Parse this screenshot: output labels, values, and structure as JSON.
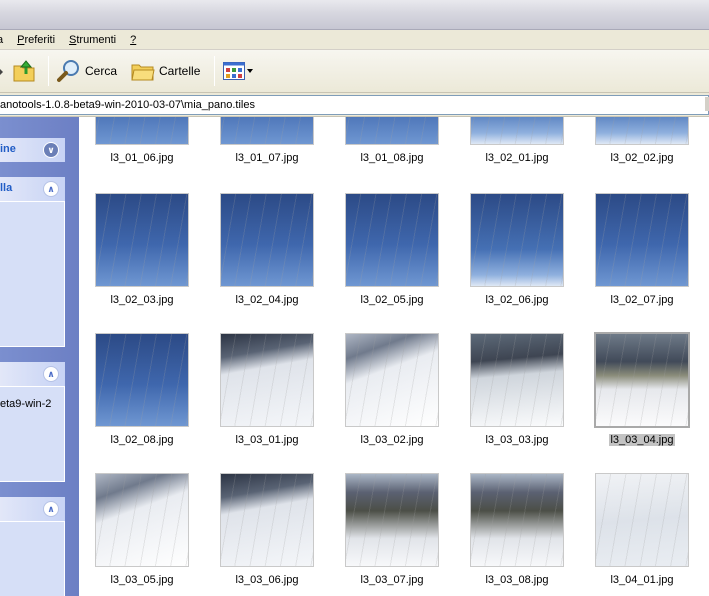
{
  "menu": {
    "items": [
      {
        "label": "a"
      },
      {
        "label": "Preferiti",
        "accel": "P",
        "rest": "referiti"
      },
      {
        "label": "Strumenti",
        "accel": "S",
        "rest": "trumenti"
      },
      {
        "label": "?",
        "accel": "?",
        "rest": ""
      }
    ]
  },
  "toolbar": {
    "search_label": "Cerca",
    "folders_label": "Cartelle"
  },
  "address": {
    "path": "anotools-1.0.8-beta9-win-2010-03-07\\mia_pano.tiles"
  },
  "taskpane": {
    "panel1_title": "ine",
    "panel2_title": "lla",
    "panel3_text": "eta9-win-2"
  },
  "files": [
    {
      "name": "l3_01_06.jpg",
      "kind": "sky"
    },
    {
      "name": "l3_01_07.jpg",
      "kind": "sky"
    },
    {
      "name": "l3_01_08.jpg",
      "kind": "sky"
    },
    {
      "name": "l3_02_01.jpg",
      "kind": "sky-hz"
    },
    {
      "name": "l3_02_02.jpg",
      "kind": "sky-hz"
    },
    {
      "name": "l3_02_03.jpg",
      "kind": "sky"
    },
    {
      "name": "l3_02_04.jpg",
      "kind": "sky"
    },
    {
      "name": "l3_02_05.jpg",
      "kind": "sky"
    },
    {
      "name": "l3_02_06.jpg",
      "kind": "sky-hz"
    },
    {
      "name": "l3_02_07.jpg",
      "kind": "sky"
    },
    {
      "name": "l3_02_08.jpg",
      "kind": "sky"
    },
    {
      "name": "l3_03_01.jpg",
      "kind": "snow1"
    },
    {
      "name": "l3_03_02.jpg",
      "kind": "snow2"
    },
    {
      "name": "l3_03_03.jpg",
      "kind": "snow3"
    },
    {
      "name": "l3_03_04.jpg",
      "kind": "snow4",
      "selected": true
    },
    {
      "name": "l3_03_05.jpg",
      "kind": "snow2"
    },
    {
      "name": "l3_03_06.jpg",
      "kind": "snow1"
    },
    {
      "name": "l3_03_07.jpg",
      "kind": "snow5"
    },
    {
      "name": "l3_03_08.jpg",
      "kind": "snow5"
    },
    {
      "name": "l3_04_01.jpg",
      "kind": "snow6"
    }
  ]
}
